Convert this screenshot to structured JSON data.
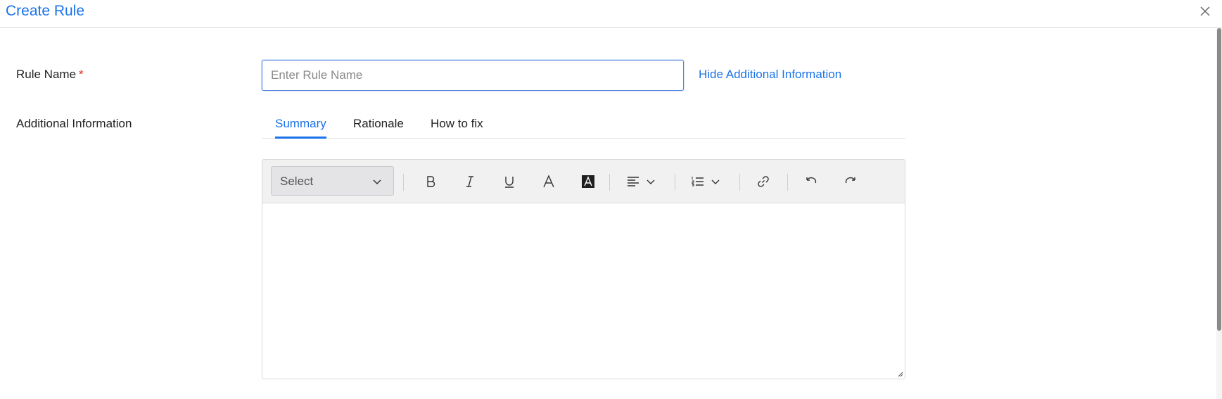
{
  "dialog": {
    "title": "Create Rule"
  },
  "form": {
    "rule_name_label": "Rule Name",
    "required_marker": "*",
    "rule_name_placeholder": "Enter Rule Name",
    "rule_name_value": "",
    "hide_info_link": "Hide Additional Information",
    "additional_info_label": "Additional Information"
  },
  "tabs": [
    {
      "label": "Summary",
      "active": true
    },
    {
      "label": "Rationale",
      "active": false
    },
    {
      "label": "How to fix",
      "active": false
    }
  ],
  "editor": {
    "format_select_value": "Select",
    "toolbar_icons": [
      "bold-icon",
      "italic-icon",
      "underline-icon",
      "font-color-icon",
      "background-color-icon",
      "align-icon",
      "list-icon",
      "link-icon",
      "undo-icon",
      "redo-icon"
    ],
    "content": ""
  },
  "colors": {
    "accent": "#1a73e8",
    "required": "#d93025"
  }
}
